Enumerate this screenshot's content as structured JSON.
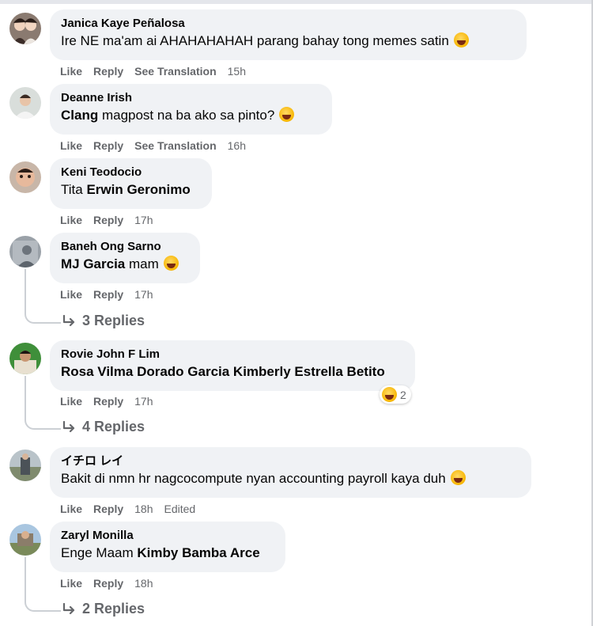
{
  "comments": [
    {
      "author": "Janica Kaye Peñalosa",
      "text": "Ire NE ma'am ai AHAHAHAHAH parang bahay tong memes satin",
      "actions": {
        "like": "Like",
        "reply": "Reply",
        "translate": "See Translation",
        "time": "15h"
      }
    },
    {
      "author": "Deanne Irish",
      "mention": "Clang",
      "text": " magpost na ba ako sa pinto?",
      "actions": {
        "like": "Like",
        "reply": "Reply",
        "translate": "See Translation",
        "time": "16h"
      }
    },
    {
      "author": "Keni Teodocio",
      "text_before": "Tita ",
      "mention": "Erwin Geronimo",
      "actions": {
        "like": "Like",
        "reply": "Reply",
        "time": "17h"
      }
    },
    {
      "author": "Baneh Ong Sarno",
      "mention": "MJ Garcia",
      "text": " mam",
      "actions": {
        "like": "Like",
        "reply": "Reply",
        "time": "17h"
      },
      "replies": "3 Replies"
    },
    {
      "author": "Rovie John F Lim",
      "mention": "Rosa Vilma Dorado Garcia Kimberly Estrella Betito",
      "reaction_count": "2",
      "actions": {
        "like": "Like",
        "reply": "Reply",
        "time": "17h"
      },
      "replies": "4 Replies"
    },
    {
      "author": "イチロ レイ",
      "text": "Bakit di nmn hr nagcocompute nyan accounting payroll kaya duh",
      "actions": {
        "like": "Like",
        "reply": "Reply",
        "time": "18h",
        "edited": "Edited"
      }
    },
    {
      "author": "Zaryl Monilla",
      "text_before": "Enge Maam ",
      "mention": "Kimby Bamba Arce",
      "actions": {
        "like": "Like",
        "reply": "Reply",
        "time": "18h"
      },
      "replies": "2 Replies"
    }
  ]
}
